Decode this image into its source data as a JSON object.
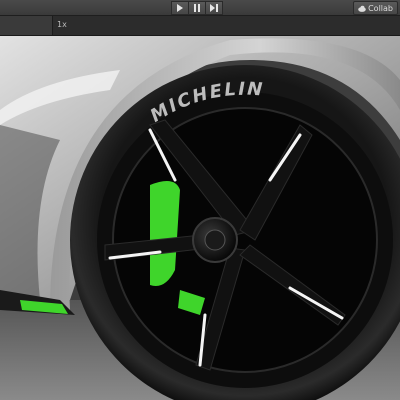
{
  "toolbar": {
    "play_icon": "play-icon",
    "pause_icon": "pause-icon",
    "step_icon": "step-forward-icon",
    "collab_label": "Collab"
  },
  "game_view": {
    "scale_label": "1x"
  },
  "scene": {
    "tire_brand": "MICHELIN",
    "accent_color": "#3fd52b",
    "body_color": "#bdbdbd"
  }
}
